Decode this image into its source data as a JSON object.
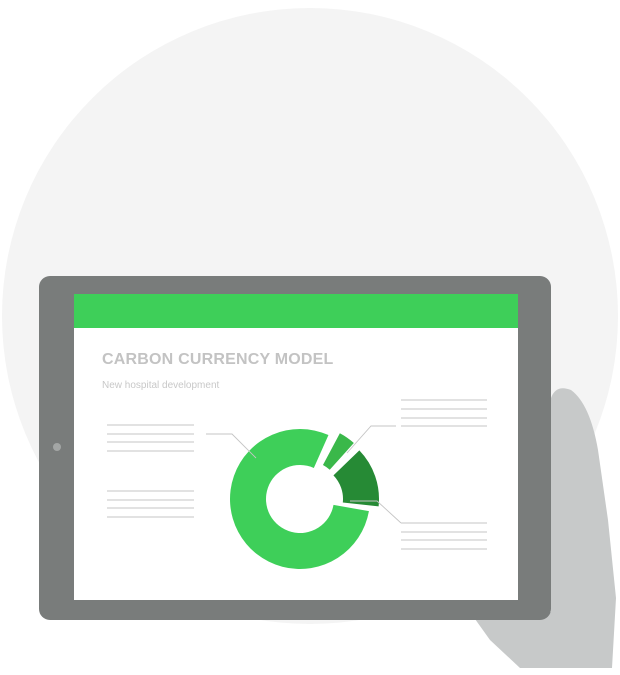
{
  "screen": {
    "title": "CARBON CURRENCY MODEL",
    "subtitle": "New hospital development"
  },
  "colors": {
    "background_circle": "#f4f4f4",
    "tablet_frame": "#797c7b",
    "header_bar": "#3ecf59",
    "donut_large": "#3ecf59",
    "donut_small": "#3ab84a",
    "donut_medium": "#268a35",
    "hand": "#c7c9c9",
    "placeholder_lines": "#c5c5c5"
  },
  "icons": {
    "camera": "camera-icon",
    "hand": "hand-illustration"
  },
  "chart_data": {
    "type": "pie",
    "style": "donut",
    "labels": [],
    "values": [
      0.8,
      0.05,
      0.15
    ],
    "legend": "placeholder-lines"
  }
}
